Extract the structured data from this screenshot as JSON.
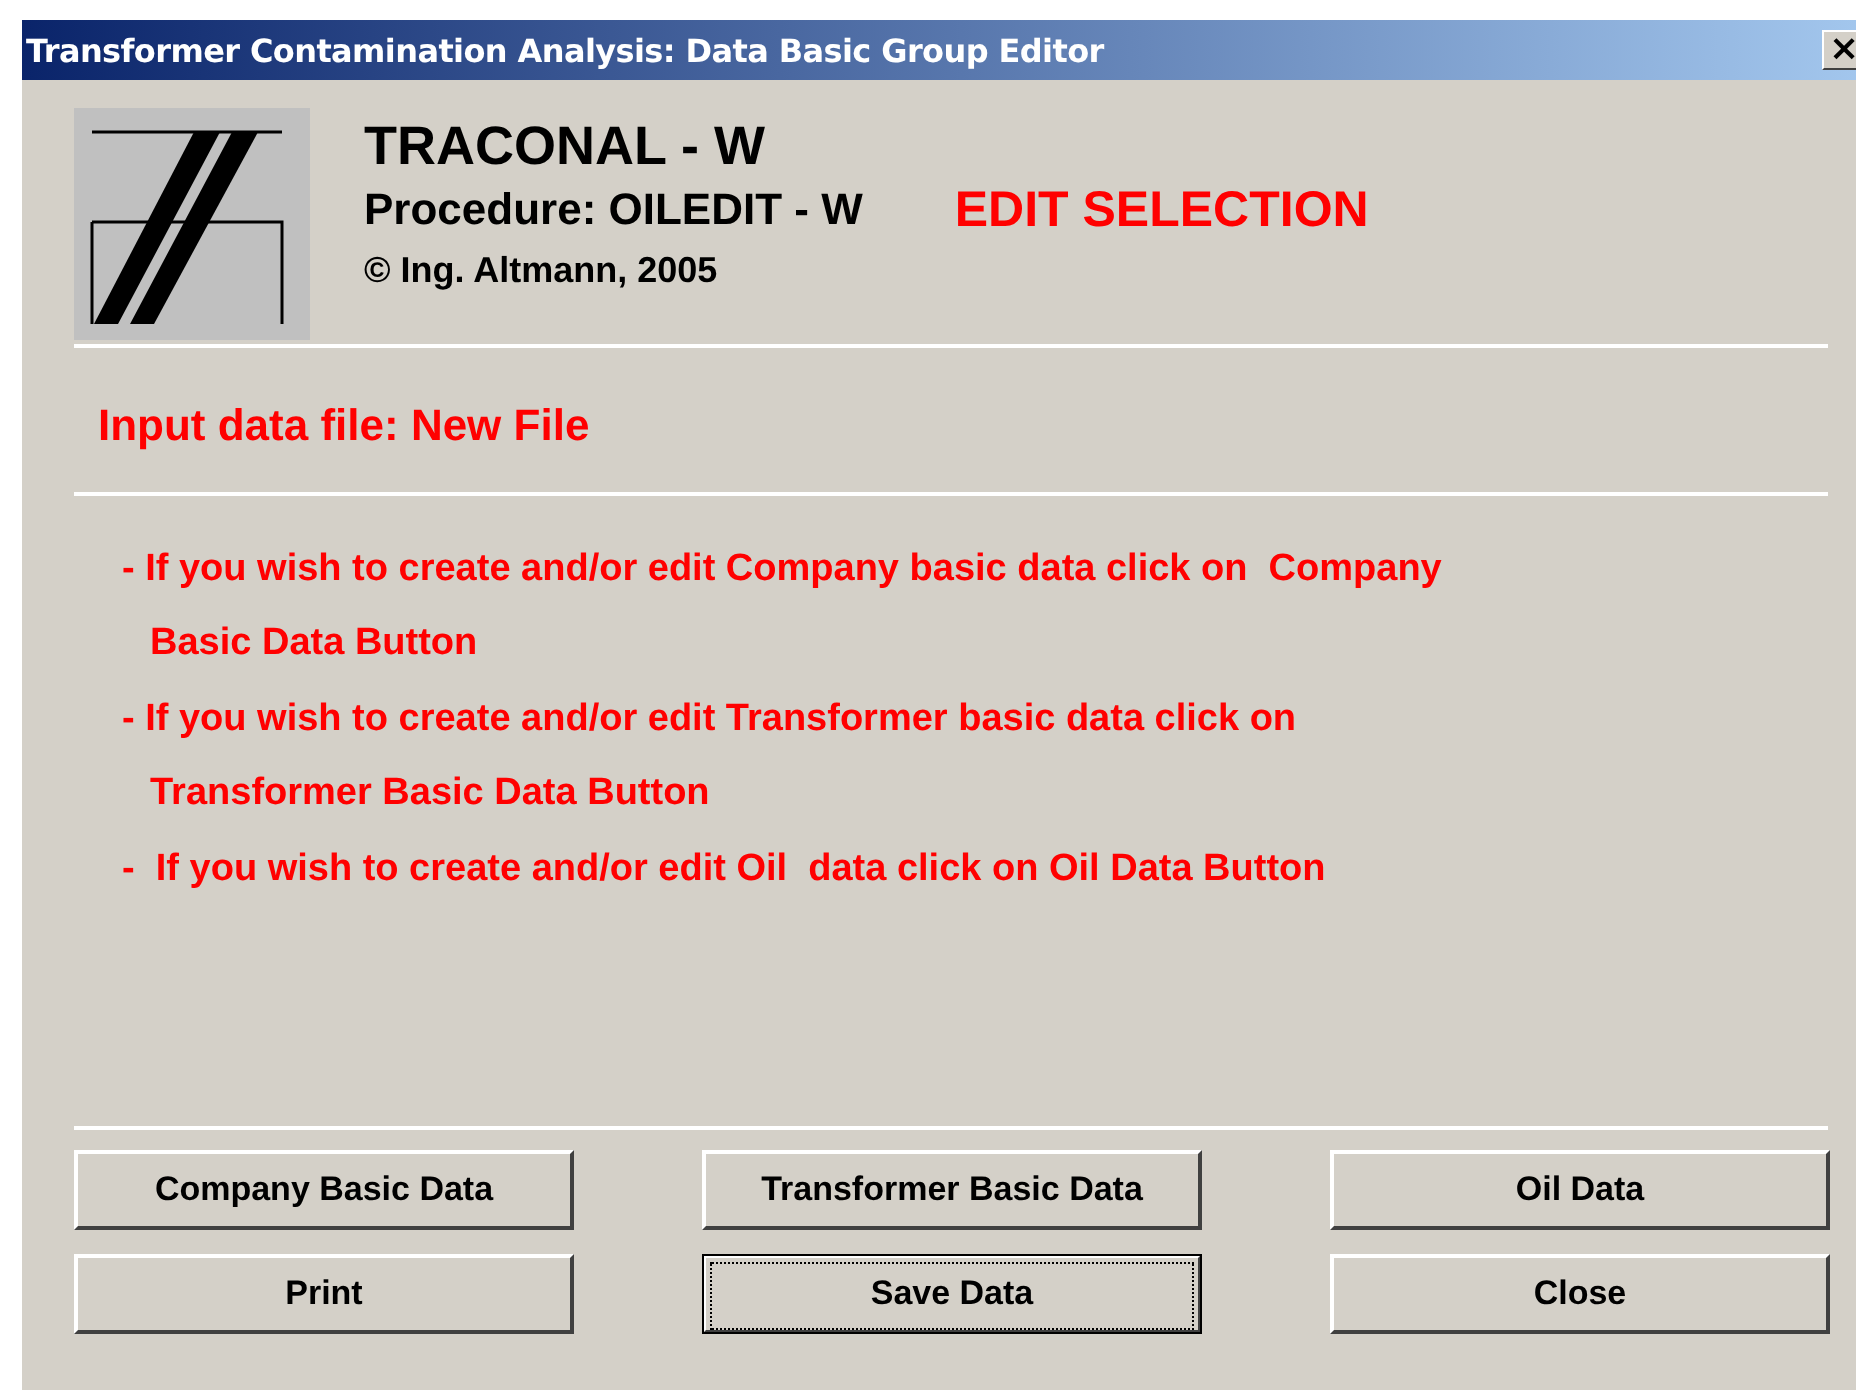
{
  "window": {
    "title": "Transformer Contamination Analysis: Data Basic Group Editor",
    "close_glyph": "×"
  },
  "header": {
    "app_name": "TRACONAL - W",
    "procedure": "Procedure: OILEDIT - W",
    "mode": "EDIT SELECTION",
    "copyright": "© Ing. Altmann, 2005"
  },
  "input_file": "Input data file: New File",
  "instructions": [
    {
      "line1": "- If you wish to create and/or edit Company basic data click on  Company",
      "line2": "Basic Data Button"
    },
    {
      "line1": "- If you wish to create and/or edit Transformer basic data click on",
      "line2": "Transformer Basic Data Button"
    },
    {
      "line1": "-  If you wish to create and/or edit Oil  data click on Oil Data Button"
    }
  ],
  "buttons": [
    {
      "label": "Company Basic Data",
      "focused": false
    },
    {
      "label": "Transformer Basic Data",
      "focused": false
    },
    {
      "label": "Oil Data",
      "focused": false
    },
    {
      "label": "Print",
      "focused": false
    },
    {
      "label": "Save Data",
      "focused": true
    },
    {
      "label": "Close",
      "focused": false
    }
  ]
}
